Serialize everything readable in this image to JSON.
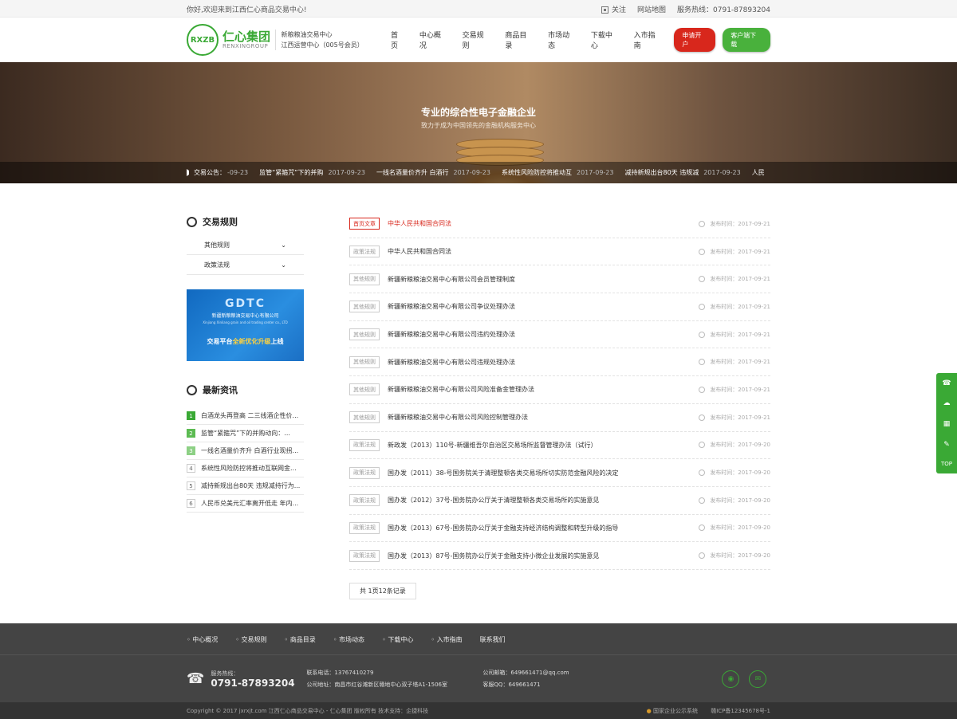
{
  "topbar": {
    "welcome": "你好,欢迎来到江西仁心商品交易中心!",
    "follow": "关注",
    "sitemap": "网站地图",
    "hotline": "服务热线：0791-87893204"
  },
  "header": {
    "logo_mark": "RXZB",
    "logo_cn": "仁心集团",
    "logo_en": "RENXINGROUP",
    "sub1": "新粮粮油交易中心",
    "sub2": "江西运营中心（005号会员）",
    "nav": [
      "首页",
      "中心概况",
      "交易规则",
      "商品目录",
      "市场动态",
      "下载中心",
      "入市指南"
    ],
    "apply": "申请开户",
    "download": "客户端下载"
  },
  "banner": {
    "title": "专业的综合性电子金融企业",
    "subtitle": "致力于成为中国领先的金融机构服务中心",
    "ticker_label": "交易公告：",
    "ticker": [
      {
        "text": "",
        "date": "-09-23"
      },
      {
        "text": "监管“紧箍咒”下的并购",
        "date": "2017-09-23"
      },
      {
        "text": "一线名酒量价齐升 白酒行",
        "date": "2017-09-23"
      },
      {
        "text": "系统性风险防控将推动互",
        "date": "2017-09-23"
      },
      {
        "text": "减持新规出台80天 违规减",
        "date": "2017-09-23"
      },
      {
        "text": "人民",
        "date": ""
      }
    ]
  },
  "sidebar": {
    "title": "交易规则",
    "menu": [
      "其他规则",
      "政策法规"
    ],
    "ad": {
      "logo": "GDTC",
      "company": "新疆新粮粮油交易中心有限公司",
      "company_en": "Xinjiang Xinliang grain and oil trading center co., LTD",
      "line_a": "交易平台",
      "line_b": "全新优化升级",
      "line_c": "上线"
    },
    "news_title": "最新资讯",
    "news": [
      "白酒龙头再登高 二三线酒企性价...",
      "监管“紧箍咒”下的并购动向：...",
      "一线名酒量价齐升 白酒行业现拐...",
      "系统性风险防控将推动互联网金...",
      "减持新规出台80天 违规减持行为...",
      "人民币兑美元汇率离开低走 年内..."
    ]
  },
  "articles": [
    {
      "tag": "首页文章",
      "title": "中华人民共和国合同法",
      "date": "发布时间：2017-09-21",
      "highlight": true
    },
    {
      "tag": "政策法规",
      "title": "中华人民共和国合同法",
      "date": "发布时间：2017-09-21"
    },
    {
      "tag": "其他规则",
      "title": "新疆新粮粮油交易中心有限公司会员管理制度",
      "date": "发布时间：2017-09-21"
    },
    {
      "tag": "其他规则",
      "title": "新疆新粮粮油交易中心有限公司争议处理办法",
      "date": "发布时间：2017-09-21"
    },
    {
      "tag": "其他规则",
      "title": "新疆新粮粮油交易中心有限公司违约处理办法",
      "date": "发布时间：2017-09-21"
    },
    {
      "tag": "其他规则",
      "title": "新疆新粮粮油交易中心有限公司违规处理办法",
      "date": "发布时间：2017-09-21"
    },
    {
      "tag": "其他规则",
      "title": "新疆新粮粮油交易中心有限公司风险准备金管理办法",
      "date": "发布时间：2017-09-21"
    },
    {
      "tag": "其他规则",
      "title": "新疆新粮粮油交易中心有限公司风险控制管理办法",
      "date": "发布时间：2017-09-21"
    },
    {
      "tag": "政策法规",
      "title": "新政发（2013）110号-新疆维吾尔自治区交易场所监督管理办法（试行）",
      "date": "发布时间：2017-09-20"
    },
    {
      "tag": "政策法规",
      "title": "国办发（2011）38-号国务院关于清理整顿各类交易场所切实防范金融风险的决定",
      "date": "发布时间：2017-09-20"
    },
    {
      "tag": "政策法规",
      "title": "国办发（2012）37号-国务院办公厅关于清理整顿各类交易场所的实施意见",
      "date": "发布时间：2017-09-20"
    },
    {
      "tag": "政策法规",
      "title": "国办发（2013）67号-国务院办公厅关于金融支持经济结构调整和转型升级的指导",
      "date": "发布时间：2017-09-20"
    },
    {
      "tag": "政策法规",
      "title": "国办发（2013）87号-国务院办公厅关于金融支持小微企业发展的实施意见",
      "date": "发布时间：2017-09-20"
    }
  ],
  "pager": "共 1页12条记录",
  "tools": [
    "☎",
    "☁",
    "▦",
    "✎",
    "TOP"
  ],
  "footer": {
    "nav": [
      "◦ 中心概况",
      "◦ 交易规则",
      "◦ 商品目录",
      "◦ 市场动态",
      "◦ 下载中心",
      "◦ 入市指南",
      "联系我们"
    ],
    "hotline_label": "服务热线：",
    "hotline": "0791-87893204",
    "contact_phone": "联系电话：13767410279",
    "address": "公司地址：南昌市红谷滩新区赣地中心双子塔A1-1506室",
    "email": "公司邮箱：649661471@qq.com",
    "qq": "客服QQ：649661471",
    "copyright": "Copyright © 2017 jxrxjt.com 江西仁心商品交易中心 - 仁心集团 版权所有  技术支持：企捷科技",
    "gov": "国家企业公示系统",
    "icp": "赣ICP备12345678号-1"
  },
  "colors": {
    "accent": "#3aa935",
    "red": "#d8271c"
  }
}
